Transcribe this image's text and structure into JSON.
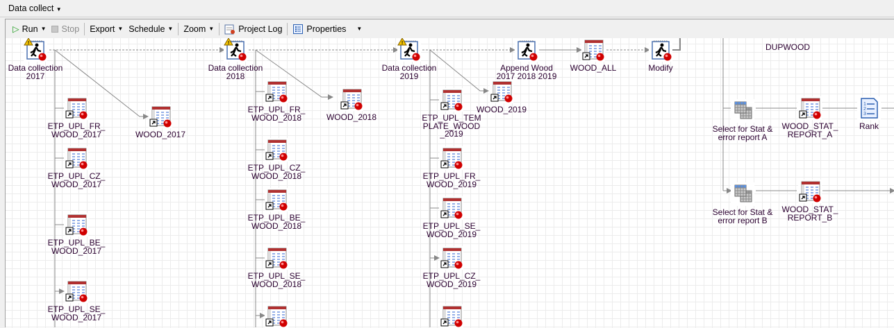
{
  "title": "Data collect",
  "toolbar": {
    "run": "Run",
    "stop": "Stop",
    "export": "Export",
    "schedule": "Schedule",
    "zoom": "Zoom",
    "project_log": "Project Log",
    "properties": "Properties"
  },
  "nodes": {
    "dc2017": "Data collection\n2017",
    "dc2018": "Data collection\n2018",
    "dc2019": "Data collection\n2019",
    "append": "Append Wood\n2017 2018 2019",
    "wood_all": "WOOD_ALL",
    "modify": "Modify",
    "wood2017": "WOOD_2017",
    "wood2018": "WOOD_2018",
    "wood2019": "WOOD_2019",
    "fr2017": "ETP_UPL_FR_\nWOOD_2017",
    "cz2017": "ETP_UPL_CZ_\nWOOD_2017",
    "be2017": "ETP_UPL_BE_\nWOOD_2017",
    "se2017": "ETP_UPL_SE_\nWOOD_2017",
    "fr2018": "ETP_UPL_FR_\nWOOD_2018",
    "cz2018": "ETP_UPL_CZ_\nWOOD_2018",
    "be2018": "ETP_UPL_BE_\nWOOD_2018",
    "se2018": "ETP_UPL_SE_\nWOOD_2018",
    "tpl2019": "ETP_UPL_TEM\nPLATE_WOOD\n_2019",
    "fr2019": "ETP_UPL_FR_\nWOOD_2019",
    "se2019": "ETP_UPL_SE_\nWOOD_2019",
    "cz2019": "ETP_UPL_CZ_\nWOOD_2019",
    "dupwood": "DUPWOOD",
    "sel_a": "Select for Stat &\nerror report A",
    "rep_a": "WOOD_STAT_\nREPORT_A",
    "rank": "Rank",
    "sel_b": "Select for Stat &\nerror report B",
    "rep_b": "WOOD_STAT_\nREPORT_B"
  },
  "colors": {
    "accent_run": "#1a9a1a",
    "status_error": "#d00000",
    "warning": "#f5c400"
  }
}
